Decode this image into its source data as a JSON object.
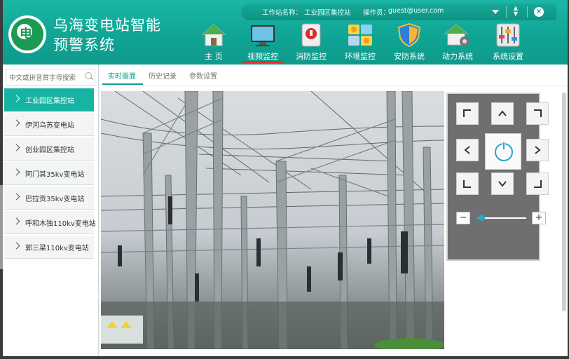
{
  "app": {
    "title_line1": "乌海变电站智能",
    "title_line2": "预警系统",
    "logo_mark": "电"
  },
  "topbar": {
    "station_label": "工作站名称：",
    "station_value": "工业园区集控站",
    "operator_label": "操作员：",
    "operator_value": "guest@user.com",
    "close_glyph": "×"
  },
  "nav": [
    {
      "label": "主 页",
      "icon": "home-icon",
      "active": false
    },
    {
      "label": "视频监控",
      "icon": "monitor-icon",
      "active": true
    },
    {
      "label": "消防监控",
      "icon": "fire-alarm-icon",
      "active": false
    },
    {
      "label": "环境监控",
      "icon": "weather-icon",
      "active": false
    },
    {
      "label": "安防系统",
      "icon": "shield-icon",
      "active": false
    },
    {
      "label": "动力系统",
      "icon": "power-house-icon",
      "active": false
    },
    {
      "label": "系统设置",
      "icon": "sliders-icon",
      "active": false
    }
  ],
  "sidebar": {
    "search_placeholder": "中文或拼音首字母搜索",
    "items": [
      {
        "label": "工业园区集控站",
        "active": true
      },
      {
        "label": "伊河乌苏变电站",
        "active": false
      },
      {
        "label": "创业园区集控站",
        "active": false
      },
      {
        "label": "阿门其35kv变电站",
        "active": false
      },
      {
        "label": "巴拉贡35kv变电站",
        "active": false
      },
      {
        "label": "呼和木独110kv变电站",
        "active": false
      },
      {
        "label": "郭三梁110kv变电站",
        "active": false
      }
    ]
  },
  "tabs": [
    {
      "label": "实时画面",
      "active": true
    },
    {
      "label": "历史记录",
      "active": false
    },
    {
      "label": "参数设置",
      "active": false
    }
  ],
  "ptz": {
    "zoom_minus": "−",
    "zoom_plus": "+",
    "zoom_level": 0.05
  },
  "colors": {
    "accent": "#18b4a3",
    "header": "#10a595",
    "active_underline": "#dd3333",
    "ptz_blue": "#2fa5c9"
  }
}
